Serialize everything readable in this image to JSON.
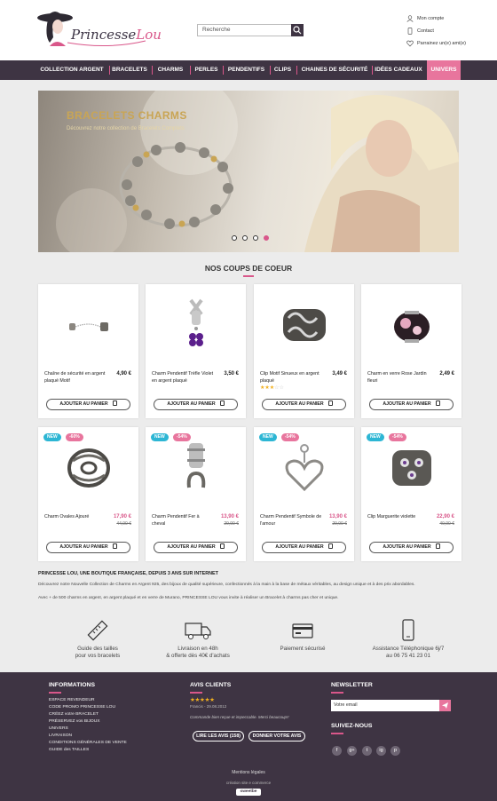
{
  "header": {
    "logo_text_a": "Princesse",
    "logo_text_b": "Lou",
    "search_placeholder": "Recherche",
    "account_links": [
      "Mon compte",
      "Contact",
      "Parrainez un(e) ami(e)"
    ]
  },
  "nav": {
    "items": [
      "COLLECTION ARGENT",
      "BRACELETS",
      "CHARMS",
      "PERLES",
      "PENDENTIFS",
      "CLIPS",
      "CHAINES DE SÉCURITÉ",
      "IDÉES CADEAUX",
      "UNIVERS"
    ]
  },
  "banner": {
    "title": "BRACELETS CHARMS",
    "subtitle": "Découvrez notre collection de Bracelets Complets",
    "slides": 4,
    "active_slide": 4
  },
  "section_title": "NOS COUPS DE COEUR",
  "products": [
    {
      "name": "Chaîne de sécurité en argent plaqué Motif",
      "price": "4,90 €",
      "old_price": "",
      "badges": [],
      "rating": 0,
      "button": "AJOUTER AU PANIER",
      "icon": "safety-chain-icon"
    },
    {
      "name": "Charm Pendentif Trèfle Violet en argent plaqué",
      "price": "3,50 €",
      "old_price": "",
      "badges": [],
      "rating": 0,
      "button": "AJOUTER AU PANIER",
      "icon": "clover-pendant-icon"
    },
    {
      "name": "Clip Motif Sinueux en argent plaqué",
      "price": "3,49 €",
      "old_price": "",
      "badges": [],
      "rating": 3,
      "button": "AJOUTER AU PANIER",
      "icon": "swirl-clip-icon"
    },
    {
      "name": "Charm en verre Rose Jardin fleuri",
      "price": "2,49 €",
      "old_price": "",
      "badges": [],
      "rating": 0,
      "button": "AJOUTER AU PANIER",
      "icon": "glass-bead-icon"
    },
    {
      "name": "Charm Ovales Ajouré",
      "price": "17,90 €",
      "old_price": "44,90 €",
      "badges": [
        "NEW",
        "-60%"
      ],
      "rating": 0,
      "button": "AJOUTER AU PANIER",
      "icon": "openwork-charm-icon"
    },
    {
      "name": "Charm Pendentif Fer à cheval",
      "price": "13,90 €",
      "old_price": "29,90 €",
      "badges": [
        "NEW",
        "-54%"
      ],
      "rating": 0,
      "button": "AJOUTER AU PANIER",
      "icon": "horseshoe-pendant-icon"
    },
    {
      "name": "Charm Pendentif Symbole de l'amour",
      "price": "13,90 €",
      "old_price": "29,90 €",
      "badges": [
        "NEW",
        "-54%"
      ],
      "rating": 0,
      "button": "AJOUTER AU PANIER",
      "icon": "heart-pendant-icon"
    },
    {
      "name": "Clip Marguerite violette",
      "price": "22,90 €",
      "old_price": "49,90 €",
      "badges": [
        "NEW",
        "-54%"
      ],
      "rating": 0,
      "button": "AJOUTER AU PANIER",
      "icon": "daisy-clip-icon"
    }
  ],
  "about": {
    "title": "PRINCESSE LOU, UNE BOUTIQUE FRANÇAISE, DEPUIS 3 ANS SUR INTERNET",
    "p1": "Découvrez notre Nouvelle Collection de Charms en Argent 925, des bijoux de qualité supérieure, confectionnés à la main à la base de métaux véritables, au design unique et à des prix abordables.",
    "p2": "Avec + de 500 charms en argent, en argent plaqué et en verre de Murano, PRINCESSE LOU vous invite à réaliser un Bracelet à charms pas cher et unique."
  },
  "features": [
    {
      "line1": "Guide des tailles",
      "line2": "pour vos bracelets",
      "icon": "ruler-icon"
    },
    {
      "line1": "Livraison en 48h",
      "line2": "& offerte dès 40€ d'achats",
      "icon": "truck-icon"
    },
    {
      "line1": "Paiement sécurisé",
      "line2": "",
      "icon": "credit-card-icon"
    },
    {
      "line1": "Assistance Téléphonique 6j/7",
      "line2": "au 06 75 41 23 01",
      "icon": "phone-icon"
    }
  ],
  "footer": {
    "info_title": "INFORMATIONS",
    "info_links": [
      "ESPACE REVENDEUR",
      "CODE PROMO PRINCESSE LOU",
      "CRÉEZ votre BRACELET",
      "PRÉSERVEZ vos BIJOUX",
      "UNIVERS",
      "LIVRAISON",
      "CONDITIONS GÉNÉRALES DE VENTE",
      "GUIDE des TAILLES"
    ],
    "reviews_title": "AVIS CLIENTS",
    "review_stars": 5,
    "review_meta": "Francis - 29.08.2012",
    "review_text": "Commande bien reçue et impeccable. Merci beaucoup!!",
    "read_reviews_btn": "LIRE LES AVIS (158)",
    "give_review_btn": "DONNER VOTRE AVIS",
    "newsletter_title": "NEWSLETTER",
    "newsletter_placeholder": "Votre email",
    "follow_title": "SUIVEZ-NOUS",
    "social": [
      "f",
      "g+",
      "t",
      "ig",
      "p"
    ],
    "legal": "Mentions légales",
    "credit": "création site e commerce",
    "credit_brand": "sweetbe"
  },
  "colors": {
    "brand_dark": "#3e3443",
    "brand_pink": "#e8759d",
    "new_badge": "#2db6d4",
    "stars": "#f2b01e"
  }
}
